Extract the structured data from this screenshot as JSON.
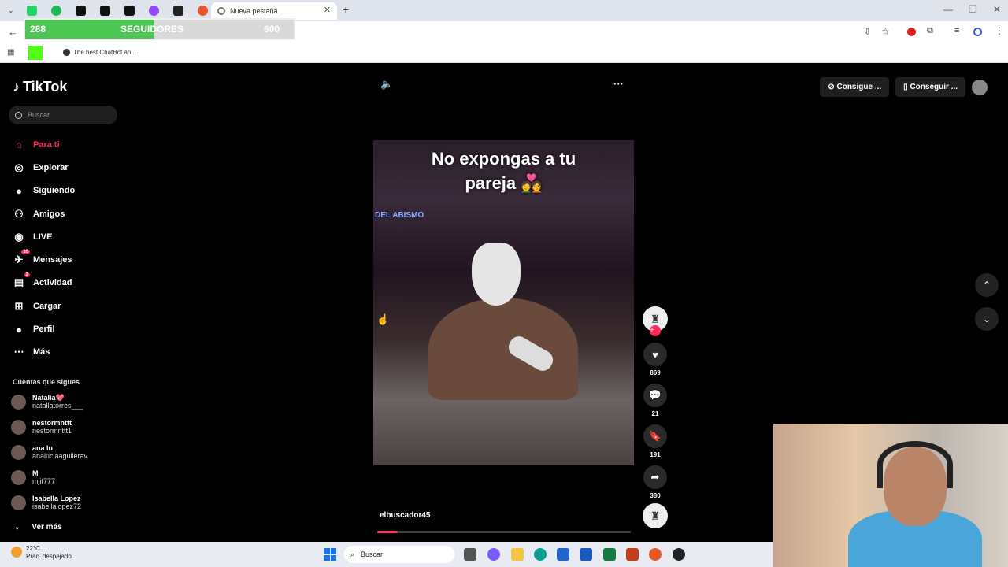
{
  "browser": {
    "active_tab_title": "Nueva pestaña",
    "bookmark_item": "The best ChatBot an..."
  },
  "followers_widget": {
    "current": "288",
    "label": "SEGUIDORES",
    "goal": "600",
    "progress_fraction": 0.48
  },
  "tiktok": {
    "logo": "TikTok",
    "search_placeholder": "Buscar",
    "nav": [
      {
        "label": "Para ti",
        "icon": "home-icon"
      },
      {
        "label": "Explorar",
        "icon": "compass-icon"
      },
      {
        "label": "Siguiendo",
        "icon": "following-icon"
      },
      {
        "label": "Amigos",
        "icon": "friends-icon"
      },
      {
        "label": "LIVE",
        "icon": "live-icon"
      },
      {
        "label": "Mensajes",
        "icon": "messages-icon",
        "badge": "35"
      },
      {
        "label": "Actividad",
        "icon": "activity-icon",
        "badge": "2"
      },
      {
        "label": "Cargar",
        "icon": "upload-icon"
      },
      {
        "label": "Perfil",
        "icon": "profile-icon"
      },
      {
        "label": "Más",
        "icon": "more-icon"
      }
    ],
    "following_title": "Cuentas que sigues",
    "accounts": [
      {
        "name": "Natalia💖",
        "handle": "natallatorres___"
      },
      {
        "name": "nestormnttt",
        "handle": "nestormnttt1"
      },
      {
        "name": "ana lu",
        "handle": "analuciaaguilerav"
      },
      {
        "name": "M",
        "handle": "mjit777"
      },
      {
        "name": "Isabella Lopez",
        "handle": "isabellalopez72"
      }
    ],
    "see_more": "Ver más",
    "top_buttons": [
      "Consigue ...",
      "Conseguir ..."
    ],
    "video": {
      "caption_line1": "No expongas a tu",
      "caption_line2": "pareja 💑",
      "overlay_text": "DEL ABISMO",
      "username": "elbuscador45",
      "progress_fraction": 0.08
    },
    "actions": {
      "likes": "869",
      "comments": "21",
      "saves": "191",
      "shares": "380"
    }
  },
  "taskbar": {
    "temperature": "22°C",
    "weather": "Prac. despejado",
    "search_placeholder": "Buscar"
  }
}
